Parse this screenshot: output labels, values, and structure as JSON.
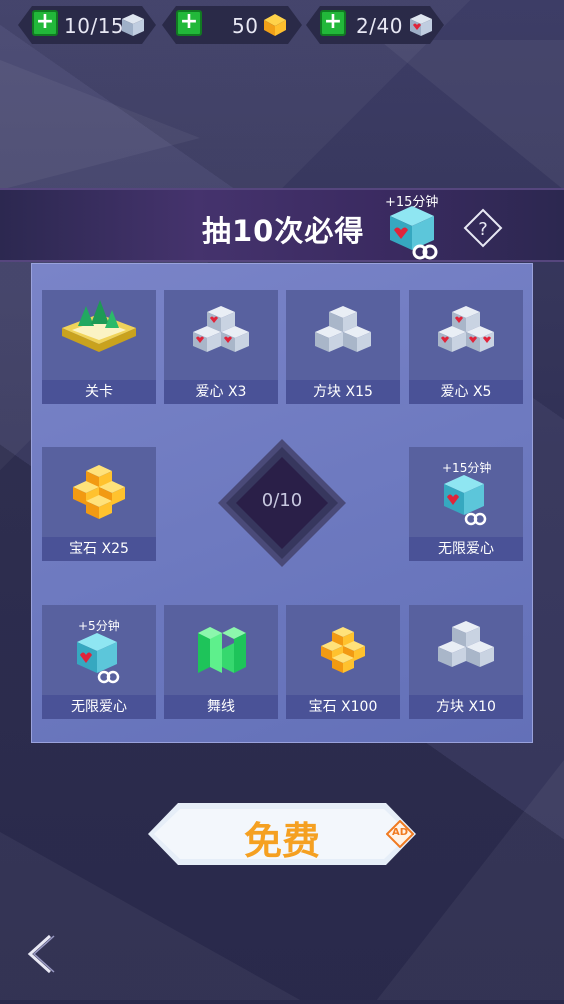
{
  "resources": [
    {
      "value": "10/15",
      "icon": "cube-icon"
    },
    {
      "value": "50",
      "icon": "gem-icon"
    },
    {
      "value": "2/40",
      "icon": "heart-cube-icon"
    }
  ],
  "banner": {
    "title": "抽10次必得",
    "prize_tag": "+15分钟",
    "help_icon": "question-mark-icon"
  },
  "grid": {
    "cells": [
      {
        "label": "关卡",
        "icon": "level-icon"
      },
      {
        "label": "爱心 X3",
        "icon": "heart-cubes-icon"
      },
      {
        "label": "方块 X15",
        "icon": "cubes-icon"
      },
      {
        "label": "爱心 X5",
        "icon": "heart-cubes-icon"
      },
      {
        "label": "宝石 X25",
        "icon": "gems-icon"
      },
      {
        "label": "无限爱心",
        "icon": "infinite-heart-icon",
        "tag": "+15分钟"
      },
      {
        "label": "无限爱心",
        "icon": "infinite-heart-icon",
        "tag": "+5分钟"
      },
      {
        "label": "舞线",
        "icon": "line-icon"
      },
      {
        "label": "宝石 X100",
        "icon": "gems-icon"
      },
      {
        "label": "方块 X10",
        "icon": "cubes-icon"
      }
    ]
  },
  "counter": {
    "text": "0/10"
  },
  "free_button": {
    "label": "免费",
    "badge": "AD"
  },
  "colors": {
    "accent_orange": "#f5a021",
    "plus_green": "#22b83a",
    "panel": "#6e7ac0",
    "banner": "#45336d"
  }
}
